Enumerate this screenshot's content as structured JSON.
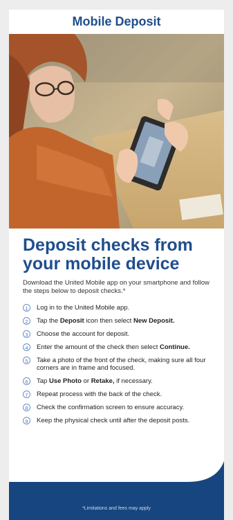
{
  "header": {
    "title": "Mobile Deposit"
  },
  "hero": {
    "image": "woman-photographing-check-with-smartphone"
  },
  "content": {
    "headline": "Deposit checks from your mobile device",
    "intro": "Download the United Mobile app on your smartphone and follow the steps below to deposit checks.*",
    "steps": [
      {
        "num": "1",
        "parts": [
          {
            "t": "Log in to the United Mobile app."
          }
        ]
      },
      {
        "num": "2",
        "parts": [
          {
            "t": "Tap the "
          },
          {
            "t": "Deposit",
            "b": true
          },
          {
            "t": " icon then select "
          },
          {
            "t": "New Deposit.",
            "b": true
          }
        ]
      },
      {
        "num": "3",
        "parts": [
          {
            "t": "Choose the account for deposit."
          }
        ]
      },
      {
        "num": "4",
        "parts": [
          {
            "t": "Enter the amount of the check then select "
          },
          {
            "t": "Continue.",
            "b": true
          }
        ]
      },
      {
        "num": "5",
        "parts": [
          {
            "t": "Take a photo of the front of the check, making sure all four corners are in frame and focused."
          }
        ]
      },
      {
        "num": "6",
        "parts": [
          {
            "t": "Tap "
          },
          {
            "t": "Use Photo",
            "b": true
          },
          {
            "t": " or "
          },
          {
            "t": "Retake,",
            "b": true
          },
          {
            "t": " if necessary."
          }
        ]
      },
      {
        "num": "7",
        "parts": [
          {
            "t": "Repeat process with the back of the check."
          }
        ]
      },
      {
        "num": "8",
        "parts": [
          {
            "t": "Check the confirmation screen to ensure accuracy."
          }
        ]
      },
      {
        "num": "9",
        "parts": [
          {
            "t": "Keep the physical check until after the deposit posts."
          }
        ]
      }
    ]
  },
  "footer": {
    "note": "*Limitations and fees may apply"
  },
  "colors": {
    "brand_blue": "#1f4e8c",
    "footer_blue": "#16457f"
  }
}
